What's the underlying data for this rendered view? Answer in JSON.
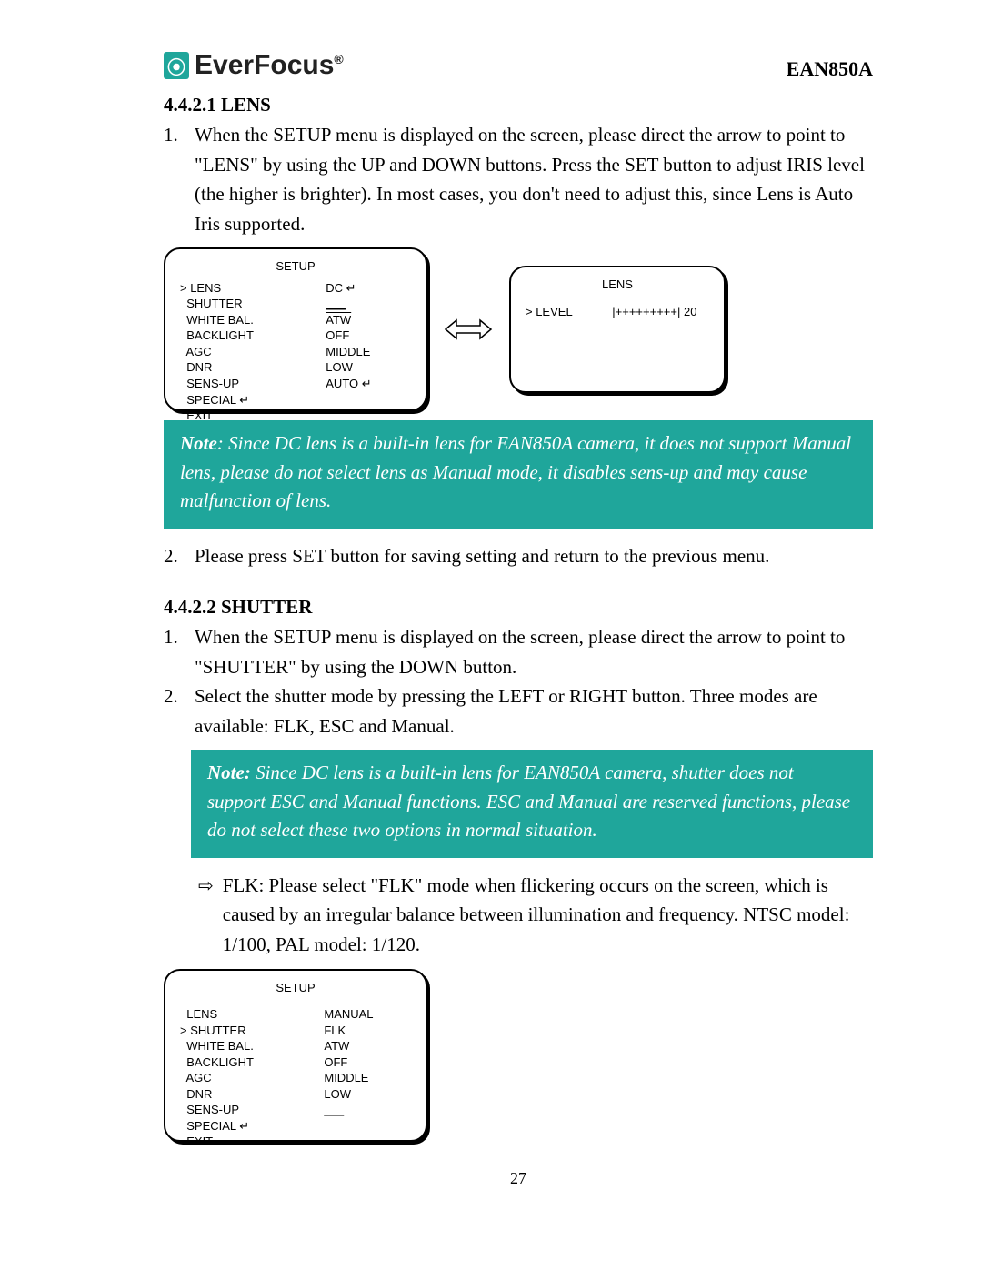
{
  "header": {
    "brand": "EverFocus",
    "brand_reg": "®",
    "model": "EAN850A"
  },
  "sec1": {
    "heading": "4.4.2.1 LENS",
    "item1_num": "1.",
    "item1_text": "When the SETUP menu is displayed on the screen, please direct the arrow to point to \"LENS\" by using the UP and DOWN buttons. Press the SET button to adjust IRIS level (the higher is brighter). In most cases, you don't need to adjust this, since Lens is Auto Iris supported.",
    "item2_num": "2.",
    "item2_text": "Please press SET button for saving setting and return to the previous menu."
  },
  "osd_setup1": {
    "title": "SETUP",
    "rows": [
      {
        "label": "> LENS",
        "value": "DC ↵"
      },
      {
        "label": "  SHUTTER",
        "value": "___"
      },
      {
        "label": "  WHITE BAL.",
        "value": "ATW"
      },
      {
        "label": "  BACKLIGHT",
        "value": "OFF"
      },
      {
        "label": "  AGC",
        "value": "MIDDLE"
      },
      {
        "label": "  DNR",
        "value": "LOW"
      },
      {
        "label": "  SENS-UP",
        "value": "AUTO ↵"
      },
      {
        "label": "  SPECIAL ↵",
        "value": ""
      },
      {
        "label": "  EXIT",
        "value": ""
      }
    ]
  },
  "osd_lens": {
    "title": "LENS",
    "row": {
      "label": "> LEVEL",
      "value": "|+++++++++| 20"
    }
  },
  "note1": {
    "label": "Note",
    "text": ": Since DC lens is a built-in lens for EAN850A camera, it does not support Manual lens, please do not select lens as Manual mode, it disables sens-up and may cause malfunction of lens."
  },
  "sec2": {
    "heading": "4.4.2.2 SHUTTER",
    "item1_num": "1.",
    "item1_text": "When the SETUP menu is displayed on the screen, please direct the arrow to point to \"SHUTTER\" by using the DOWN button.",
    "item2_num": "2.",
    "item2_text": "Select the shutter mode by pressing the LEFT or RIGHT button. Three modes are available: FLK, ESC and Manual."
  },
  "note2": {
    "label": "Note:",
    "text": " Since DC lens is a built-in lens for EAN850A camera, shutter does not support ESC and Manual functions. ESC and Manual are reserved functions, please do not select these two options in normal situation."
  },
  "flk": {
    "glyph": "⇨",
    "text": "FLK: Please select \"FLK\" mode when flickering occurs on the screen, which is caused by an irregular balance between illumination and frequency. NTSC model: 1/100, PAL model: 1/120."
  },
  "osd_setup2": {
    "title": "SETUP",
    "rows": [
      {
        "label": "  LENS",
        "value": "MANUAL"
      },
      {
        "label": "> SHUTTER",
        "value": "FLK"
      },
      {
        "label": "  WHITE BAL.",
        "value": "ATW"
      },
      {
        "label": "  BACKLIGHT",
        "value": "OFF"
      },
      {
        "label": "  AGC",
        "value": "MIDDLE"
      },
      {
        "label": "  DNR",
        "value": "LOW"
      },
      {
        "label": "  SENS-UP",
        "value": "___"
      },
      {
        "label": "  SPECIAL ↵",
        "value": ""
      },
      {
        "label": "  EXIT",
        "value": ""
      }
    ]
  },
  "page_number": "27"
}
